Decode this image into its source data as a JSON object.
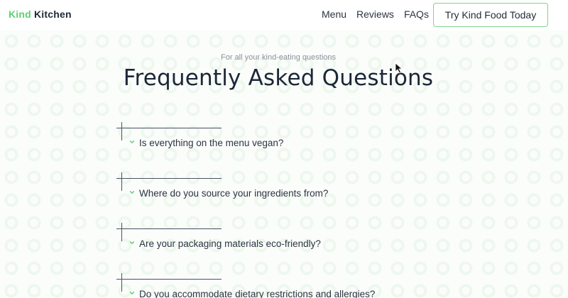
{
  "brand": {
    "part1": "Kind",
    "part2": " Kitchen",
    "accent": "#5fcf6f"
  },
  "nav": {
    "links": [
      "Menu",
      "Reviews",
      "FAQs"
    ],
    "cta": "Try Kind Food Today"
  },
  "hero": {
    "eyebrow": "For all your kind-eating questions",
    "title": "Frequently Asked Questions"
  },
  "faqs": [
    {
      "question": "Is everything on the menu vegan?",
      "icon": "chevron-down-icon"
    },
    {
      "question": "Where do you source your ingredients from?",
      "icon": "chevron-down-icon"
    },
    {
      "question": "Are your packaging materials eco-friendly?",
      "icon": "chevron-down-icon"
    },
    {
      "question": "Do you accommodate dietary restrictions and allergies?",
      "icon": "chevron-down-icon"
    }
  ]
}
